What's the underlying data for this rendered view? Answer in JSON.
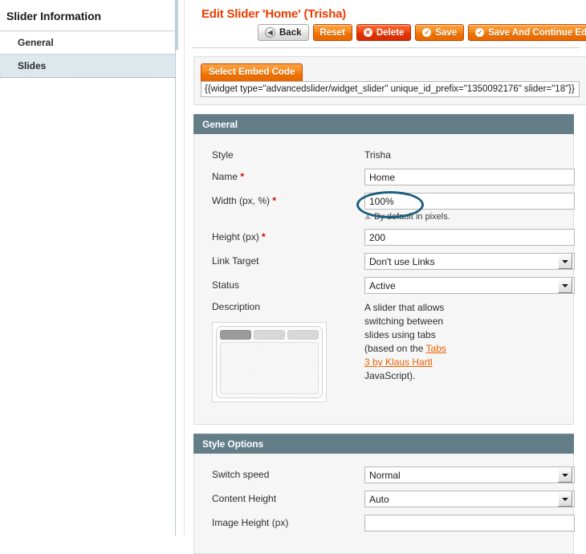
{
  "sidebar": {
    "title": "Slider Information",
    "items": [
      {
        "label": "General",
        "active": false
      },
      {
        "label": "Slides",
        "active": true
      }
    ]
  },
  "header": {
    "title": "Edit Slider 'Home' (Trisha)",
    "buttons": [
      {
        "label": "Back",
        "icon": "back-arrow-icon",
        "glyph": "◀",
        "style": "grey"
      },
      {
        "label": "Reset",
        "icon": "",
        "glyph": "",
        "style": "orange"
      },
      {
        "label": "Delete",
        "icon": "delete-circle-icon",
        "glyph": "×",
        "style": "red"
      },
      {
        "label": "Save",
        "icon": "check-circle-icon",
        "glyph": "✓",
        "style": "orange"
      },
      {
        "label": "Save And Continue Edit",
        "icon": "check-circle-icon",
        "glyph": "✓",
        "style": "orange"
      }
    ]
  },
  "embed": {
    "tab_label": "Select Embed Code",
    "code": "{{widget type=\"advancedslider/widget_slider\" unique_id_prefix=\"1350092176\" slider=\"18\"}}"
  },
  "general": {
    "heading": "General",
    "style_label": "Style",
    "style_value": "Trisha",
    "name_label": "Name",
    "name_value": "Home",
    "width_label": "Width (px, %)",
    "width_value": "100%",
    "width_note": "By default in pixels.",
    "height_label": "Height (px)",
    "height_value": "200",
    "link_target_label": "Link Target",
    "link_target_value": "Don't use Links",
    "status_label": "Status",
    "status_value": "Active",
    "description_label": "Description",
    "description_text_1": "A slider that allows switching between slides using tabs (based on the ",
    "description_link": "Tabs 3 by Klaus Hartl",
    "description_text_2": " JavaScript).",
    "required_marker": "*"
  },
  "style_options": {
    "heading": "Style Options",
    "switch_speed_label": "Switch speed",
    "switch_speed_value": "Normal",
    "content_height_label": "Content Height",
    "content_height_value": "Auto",
    "image_height_label": "Image Height (px)",
    "image_height_value": ""
  },
  "colors": {
    "accent_orange": "#ef7403",
    "title_orange": "#eb3c00",
    "section_header": "#647e88",
    "delete_red": "#e23200",
    "annotation": "#1d5f7d",
    "active_sidebar": "#dce8ec"
  }
}
